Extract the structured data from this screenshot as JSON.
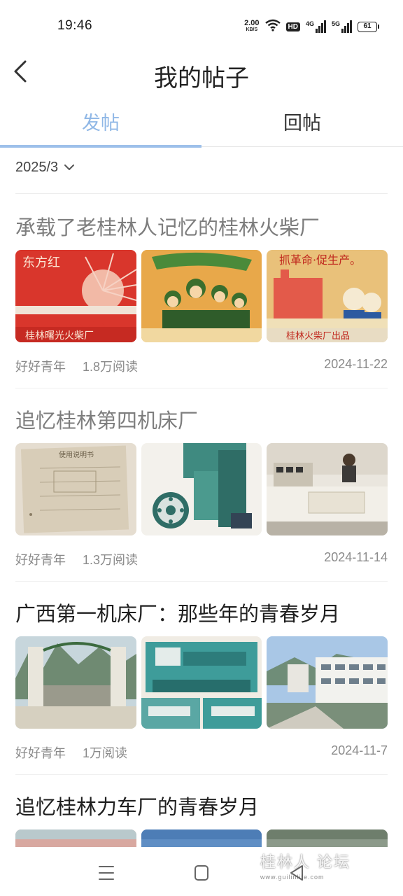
{
  "status_bar": {
    "time": "19:46",
    "net_speed_value": "2.00",
    "net_speed_unit": "KB/S",
    "hd_badge": "HD",
    "signal_1_type": "4G",
    "signal_2_type": "5G",
    "battery_level": "61",
    "icons": [
      "wifi-icon",
      "signal-4g-icon",
      "signal-5g-icon",
      "battery-icon"
    ]
  },
  "header": {
    "back_icon": "chevron-left-icon",
    "title": "我的帖子"
  },
  "tabs": [
    {
      "label": "发帖",
      "active": true
    },
    {
      "label": "回帖",
      "active": false
    }
  ],
  "filter": {
    "date_value": "2025/3",
    "icon": "chevron-down-icon"
  },
  "posts": [
    {
      "title": "承载了老桂林人记忆的桂林火柴厂",
      "author": "好好青年",
      "reads": "1.8万阅读",
      "date": "2024-11-22",
      "images": [
        {
          "caption_top": "东方红",
          "caption_bottom": "桂林曙光火柴厂"
        },
        {
          "caption_top": "",
          "caption_bottom": ""
        },
        {
          "caption_top": "抓革命·促生产。",
          "caption_bottom": "桂林火柴厂出品"
        }
      ]
    },
    {
      "title": "追忆桂林第四机床厂",
      "author": "好好青年",
      "reads": "1.3万阅读",
      "date": "2024-11-14",
      "images": [
        {
          "caption_top": "使用说明书"
        },
        {
          "caption_top": ""
        },
        {
          "caption_top": ""
        }
      ]
    },
    {
      "title": "广西第一机床厂：那些年的青春岁月",
      "author": "好好青年",
      "reads": "1万阅读",
      "date": "2024-11-7",
      "images": [
        {
          "caption_top": ""
        },
        {
          "caption_top": ""
        },
        {
          "caption_top": ""
        }
      ]
    },
    {
      "title": "追忆桂林力车厂的青春岁月"
    }
  ],
  "nav_bar": {
    "icons": [
      "menu-icon",
      "home-square-icon",
      "back-triangle-icon"
    ]
  },
  "watermark": {
    "main": "桂林人 论坛",
    "sub": "www.guilinlife.com"
  },
  "colors": {
    "accent": "#8fb7e6",
    "indicator": "#9dc0ea",
    "meta_text": "#8a8a8a",
    "faded_title": "#7d7d7d"
  }
}
